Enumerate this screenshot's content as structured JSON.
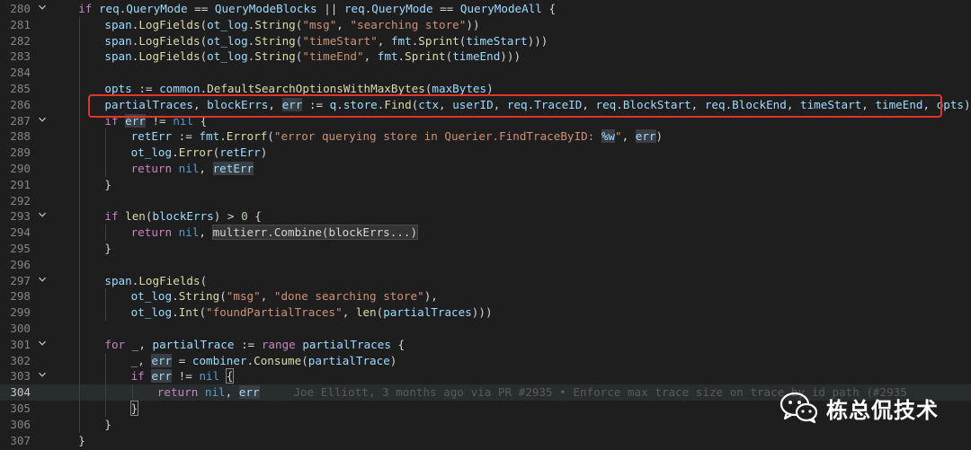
{
  "editor": {
    "lines": [
      {
        "no": "280",
        "fold": true,
        "indent": 1,
        "tokens": [
          [
            "ctl",
            "if "
          ],
          [
            "var",
            "req"
          ],
          [
            "op",
            "."
          ],
          [
            "var",
            "QueryMode"
          ],
          [
            "op",
            " == "
          ],
          [
            "var",
            "QueryModeBlocks"
          ],
          [
            "op",
            " || "
          ],
          [
            "var",
            "req"
          ],
          [
            "op",
            "."
          ],
          [
            "var",
            "QueryMode"
          ],
          [
            "op",
            " == "
          ],
          [
            "var",
            "QueryModeAll"
          ],
          [
            "op",
            " {"
          ]
        ]
      },
      {
        "no": "281",
        "indent": 2,
        "tokens": [
          [
            "var",
            "span"
          ],
          [
            "op",
            "."
          ],
          [
            "fn",
            "LogFields"
          ],
          [
            "op",
            "("
          ],
          [
            "var",
            "ot_log"
          ],
          [
            "op",
            "."
          ],
          [
            "fn",
            "String"
          ],
          [
            "op",
            "("
          ],
          [
            "str",
            "\"msg\""
          ],
          [
            "op",
            ", "
          ],
          [
            "str",
            "\"searching store\""
          ],
          [
            "op",
            "))"
          ]
        ]
      },
      {
        "no": "282",
        "indent": 2,
        "tokens": [
          [
            "var",
            "span"
          ],
          [
            "op",
            "."
          ],
          [
            "fn",
            "LogFields"
          ],
          [
            "op",
            "("
          ],
          [
            "var",
            "ot_log"
          ],
          [
            "op",
            "."
          ],
          [
            "fn",
            "String"
          ],
          [
            "op",
            "("
          ],
          [
            "str",
            "\"timeStart\""
          ],
          [
            "op",
            ", "
          ],
          [
            "var",
            "fmt"
          ],
          [
            "op",
            "."
          ],
          [
            "fn",
            "Sprint"
          ],
          [
            "op",
            "("
          ],
          [
            "var",
            "timeStart"
          ],
          [
            "op",
            ")))"
          ]
        ]
      },
      {
        "no": "283",
        "indent": 2,
        "tokens": [
          [
            "var",
            "span"
          ],
          [
            "op",
            "."
          ],
          [
            "fn",
            "LogFields"
          ],
          [
            "op",
            "("
          ],
          [
            "var",
            "ot_log"
          ],
          [
            "op",
            "."
          ],
          [
            "fn",
            "String"
          ],
          [
            "op",
            "("
          ],
          [
            "str",
            "\"timeEnd\""
          ],
          [
            "op",
            ", "
          ],
          [
            "var",
            "fmt"
          ],
          [
            "op",
            "."
          ],
          [
            "fn",
            "Sprint"
          ],
          [
            "op",
            "("
          ],
          [
            "var",
            "timeEnd"
          ],
          [
            "op",
            ")))"
          ]
        ]
      },
      {
        "no": "284",
        "indent": 0,
        "tokens": []
      },
      {
        "no": "285",
        "indent": 2,
        "tokens": [
          [
            "var",
            "opts"
          ],
          [
            "op",
            " := "
          ],
          [
            "var",
            "common"
          ],
          [
            "op",
            "."
          ],
          [
            "fn",
            "DefaultSearchOptionsWithMaxBytes"
          ],
          [
            "op",
            "("
          ],
          [
            "var",
            "maxBytes"
          ],
          [
            "op",
            ")"
          ]
        ]
      },
      {
        "no": "286",
        "indent": 2,
        "tokens": [
          [
            "var",
            "partialTraces"
          ],
          [
            "op",
            ", "
          ],
          [
            "var",
            "blockErrs"
          ],
          [
            "op",
            ", "
          ],
          [
            "hl",
            "err"
          ],
          [
            "op",
            " := "
          ],
          [
            "var",
            "q"
          ],
          [
            "op",
            "."
          ],
          [
            "var",
            "store"
          ],
          [
            "op",
            "."
          ],
          [
            "fn",
            "Find"
          ],
          [
            "op",
            "("
          ],
          [
            "var",
            "ctx"
          ],
          [
            "op",
            ", "
          ],
          [
            "var",
            "userID"
          ],
          [
            "op",
            ", "
          ],
          [
            "var",
            "req"
          ],
          [
            "op",
            "."
          ],
          [
            "var",
            "TraceID"
          ],
          [
            "op",
            ", "
          ],
          [
            "var",
            "req"
          ],
          [
            "op",
            "."
          ],
          [
            "var",
            "BlockStart"
          ],
          [
            "op",
            ", "
          ],
          [
            "var",
            "req"
          ],
          [
            "op",
            "."
          ],
          [
            "var",
            "BlockEnd"
          ],
          [
            "op",
            ", "
          ],
          [
            "var",
            "timeStart"
          ],
          [
            "op",
            ", "
          ],
          [
            "var",
            "timeEnd"
          ],
          [
            "op",
            ", "
          ],
          [
            "var",
            "opts"
          ],
          [
            "op",
            ")"
          ]
        ]
      },
      {
        "no": "287",
        "fold": true,
        "indent": 2,
        "tokens": [
          [
            "ctl",
            "if "
          ],
          [
            "hl",
            "err"
          ],
          [
            "op",
            " != "
          ],
          [
            "kw",
            "nil"
          ],
          [
            "op",
            " {"
          ]
        ]
      },
      {
        "no": "288",
        "indent": 3,
        "tokens": [
          [
            "var",
            "retErr"
          ],
          [
            "op",
            " := "
          ],
          [
            "var",
            "fmt"
          ],
          [
            "op",
            "."
          ],
          [
            "fn",
            "Errorf"
          ],
          [
            "op",
            "("
          ],
          [
            "str",
            "\"error querying store in Querier.FindTraceByID: "
          ],
          [
            "fmt",
            "%w"
          ],
          [
            "str",
            "\""
          ],
          [
            "op",
            ", "
          ],
          [
            "hl",
            "err"
          ],
          [
            "op",
            ")"
          ]
        ]
      },
      {
        "no": "289",
        "indent": 3,
        "tokens": [
          [
            "var",
            "ot_log"
          ],
          [
            "op",
            "."
          ],
          [
            "fn",
            "Error"
          ],
          [
            "op",
            "("
          ],
          [
            "var",
            "retErr"
          ],
          [
            "op",
            ")"
          ]
        ]
      },
      {
        "no": "290",
        "indent": 3,
        "tokens": [
          [
            "ctl",
            "return "
          ],
          [
            "kw",
            "nil"
          ],
          [
            "op",
            ", "
          ],
          [
            "hl",
            "retErr"
          ]
        ]
      },
      {
        "no": "291",
        "indent": 2,
        "tokens": [
          [
            "op",
            "}"
          ]
        ]
      },
      {
        "no": "292",
        "indent": 0,
        "tokens": []
      },
      {
        "no": "293",
        "fold": true,
        "indent": 2,
        "tokens": [
          [
            "ctl",
            "if "
          ],
          [
            "fn",
            "len"
          ],
          [
            "op",
            "("
          ],
          [
            "var",
            "blockErrs"
          ],
          [
            "op",
            ") > "
          ],
          [
            "num",
            "0"
          ],
          [
            "op",
            " {"
          ]
        ]
      },
      {
        "no": "294",
        "indent": 3,
        "tokens": [
          [
            "ctl",
            "return "
          ],
          [
            "kw",
            "nil"
          ],
          [
            "op",
            ", "
          ],
          [
            "hl2",
            "multierr.Combine(blockErrs...)"
          ]
        ]
      },
      {
        "no": "295",
        "indent": 2,
        "tokens": [
          [
            "op",
            "}"
          ]
        ]
      },
      {
        "no": "296",
        "indent": 0,
        "tokens": []
      },
      {
        "no": "297",
        "fold": true,
        "indent": 2,
        "tokens": [
          [
            "var",
            "span"
          ],
          [
            "op",
            "."
          ],
          [
            "fn",
            "LogFields"
          ],
          [
            "op",
            "("
          ]
        ]
      },
      {
        "no": "298",
        "indent": 3,
        "tokens": [
          [
            "var",
            "ot_log"
          ],
          [
            "op",
            "."
          ],
          [
            "fn",
            "String"
          ],
          [
            "op",
            "("
          ],
          [
            "str",
            "\"msg\""
          ],
          [
            "op",
            ", "
          ],
          [
            "str",
            "\"done searching store\""
          ],
          [
            "op",
            "),"
          ]
        ]
      },
      {
        "no": "299",
        "indent": 3,
        "tokens": [
          [
            "var",
            "ot_log"
          ],
          [
            "op",
            "."
          ],
          [
            "fn",
            "Int"
          ],
          [
            "op",
            "("
          ],
          [
            "str",
            "\"foundPartialTraces\""
          ],
          [
            "op",
            ", "
          ],
          [
            "fn",
            "len"
          ],
          [
            "op",
            "("
          ],
          [
            "var",
            "partialTraces"
          ],
          [
            "op",
            ")))"
          ]
        ]
      },
      {
        "no": "300",
        "indent": 0,
        "tokens": []
      },
      {
        "no": "301",
        "fold": true,
        "indent": 2,
        "tokens": [
          [
            "ctl",
            "for "
          ],
          [
            "var",
            "_"
          ],
          [
            "op",
            ", "
          ],
          [
            "var",
            "partialTrace"
          ],
          [
            "op",
            " := "
          ],
          [
            "ctl",
            "range "
          ],
          [
            "var",
            "partialTraces"
          ],
          [
            "op",
            " {"
          ]
        ]
      },
      {
        "no": "302",
        "indent": 3,
        "tokens": [
          [
            "var",
            "_"
          ],
          [
            "op",
            ", "
          ],
          [
            "hl",
            "err"
          ],
          [
            "op",
            " = "
          ],
          [
            "var",
            "combiner"
          ],
          [
            "op",
            "."
          ],
          [
            "fn",
            "Consume"
          ],
          [
            "op",
            "("
          ],
          [
            "var",
            "partialTrace"
          ],
          [
            "op",
            ")"
          ]
        ]
      },
      {
        "no": "303",
        "fold": true,
        "indent": 3,
        "tokens": [
          [
            "ctl",
            "if "
          ],
          [
            "hl",
            "err"
          ],
          [
            "op",
            " != "
          ],
          [
            "kw",
            "nil"
          ],
          [
            "op",
            " "
          ],
          [
            "bm",
            "{"
          ]
        ]
      },
      {
        "no": "304",
        "indent": 4,
        "current": true,
        "tokens": [
          [
            "ctl",
            "return "
          ],
          [
            "kw",
            "nil"
          ],
          [
            "op",
            ", "
          ],
          [
            "hl",
            "err"
          ]
        ],
        "blame": "Joe Elliott, 3 months ago via PR #2935 • Enforce max trace size on trace by id path (#2935"
      },
      {
        "no": "305",
        "indent": 3,
        "tokens": [
          [
            "bm",
            "}"
          ]
        ]
      },
      {
        "no": "306",
        "indent": 2,
        "tokens": [
          [
            "op",
            "}"
          ]
        ]
      },
      {
        "no": "307",
        "indent": 1,
        "tokens": [
          [
            "op",
            "}"
          ]
        ]
      }
    ]
  },
  "watermark": {
    "text": "栋总侃技术",
    "icon": "wechat-icon"
  },
  "colors": {
    "background": "#1e1e1e",
    "highlight_box": "#e0352f"
  }
}
